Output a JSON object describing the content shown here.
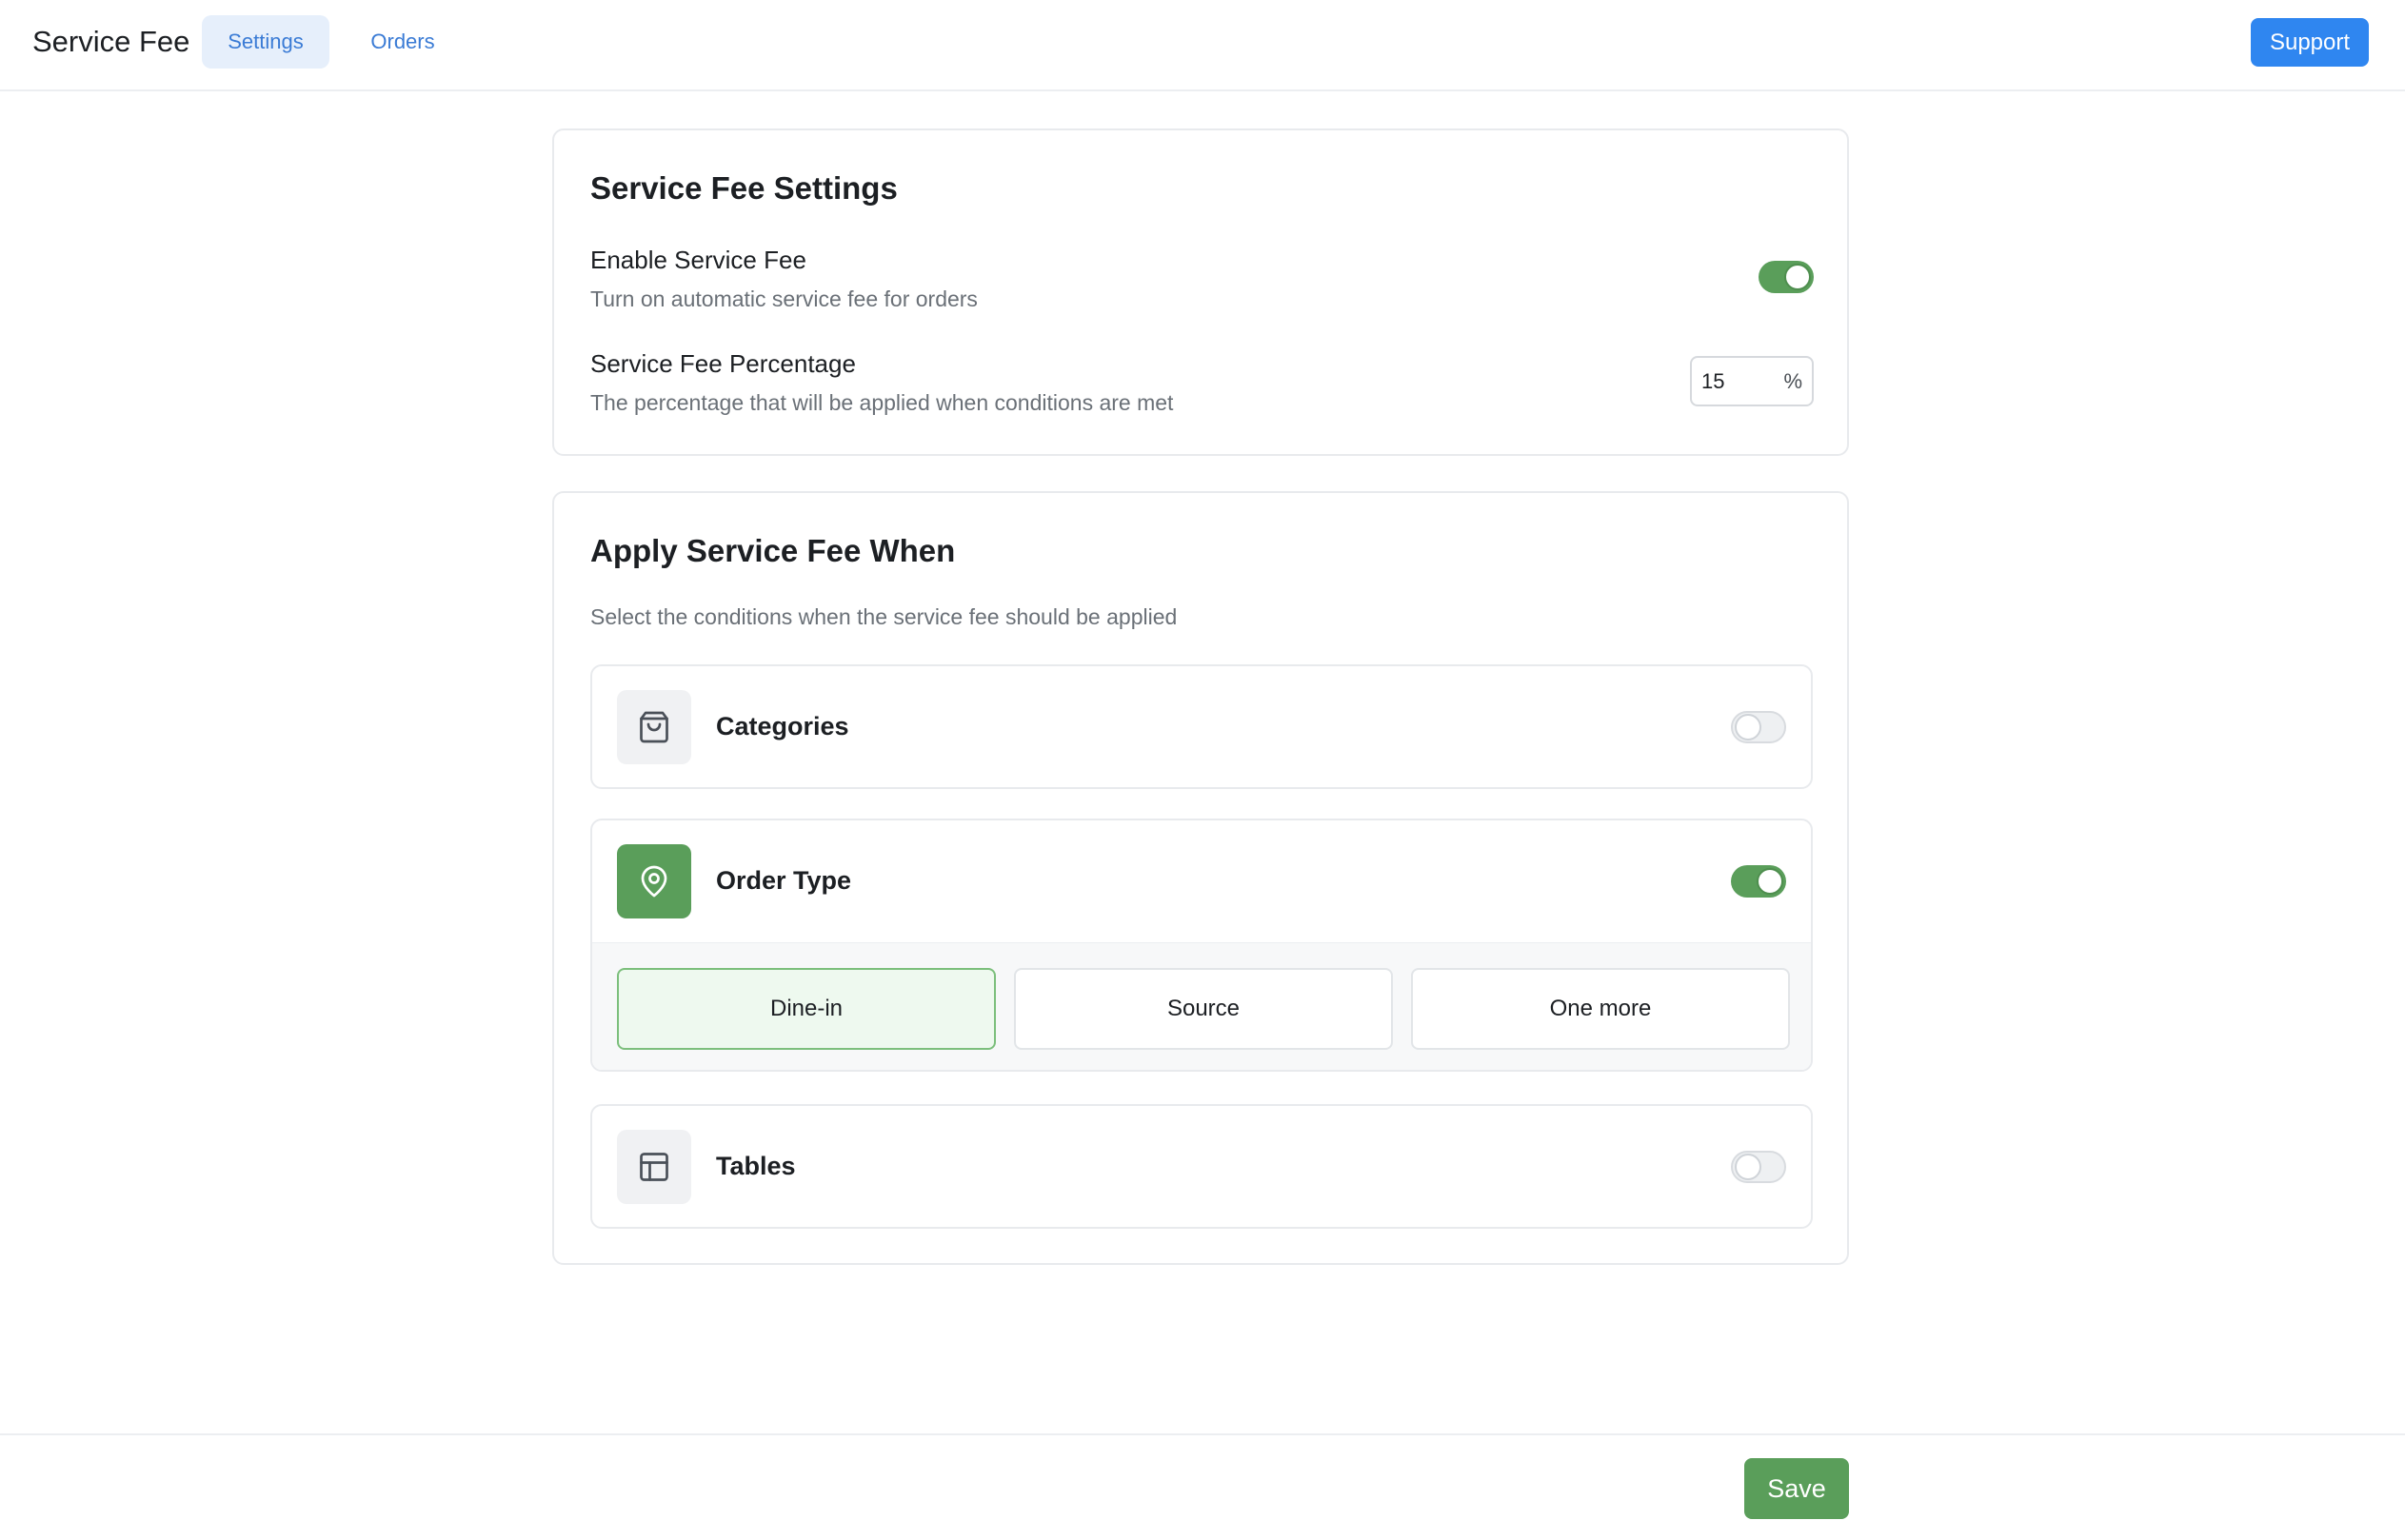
{
  "header": {
    "title": "Service Fee",
    "tabs": [
      {
        "label": "Settings",
        "active": true
      },
      {
        "label": "Orders",
        "active": false
      }
    ],
    "support_label": "Support"
  },
  "settings_card": {
    "title": "Service Fee Settings",
    "enable": {
      "label": "Enable Service Fee",
      "description": "Turn on automatic service fee for orders",
      "enabled": true
    },
    "percentage": {
      "label": "Service Fee Percentage",
      "description": "The percentage that will be applied when conditions are met",
      "value": "15",
      "suffix": "%"
    }
  },
  "conditions_card": {
    "title": "Apply Service Fee When",
    "description": "Select the conditions when the service fee should be applied",
    "conditions": [
      {
        "label": "Categories",
        "icon": "shopping-bag-icon",
        "enabled": false
      },
      {
        "label": "Order Type",
        "icon": "map-pin-icon",
        "enabled": true,
        "options": [
          {
            "label": "Dine-in",
            "selected": true
          },
          {
            "label": "Source",
            "selected": false
          },
          {
            "label": "One more",
            "selected": false
          }
        ]
      },
      {
        "label": "Tables",
        "icon": "table-layout-icon",
        "enabled": false
      }
    ]
  },
  "footer": {
    "save_label": "Save"
  },
  "colors": {
    "primary_blue": "#2f86f0",
    "accent_green": "#5a9e5a",
    "selected_option_bg": "#eef9ef"
  }
}
